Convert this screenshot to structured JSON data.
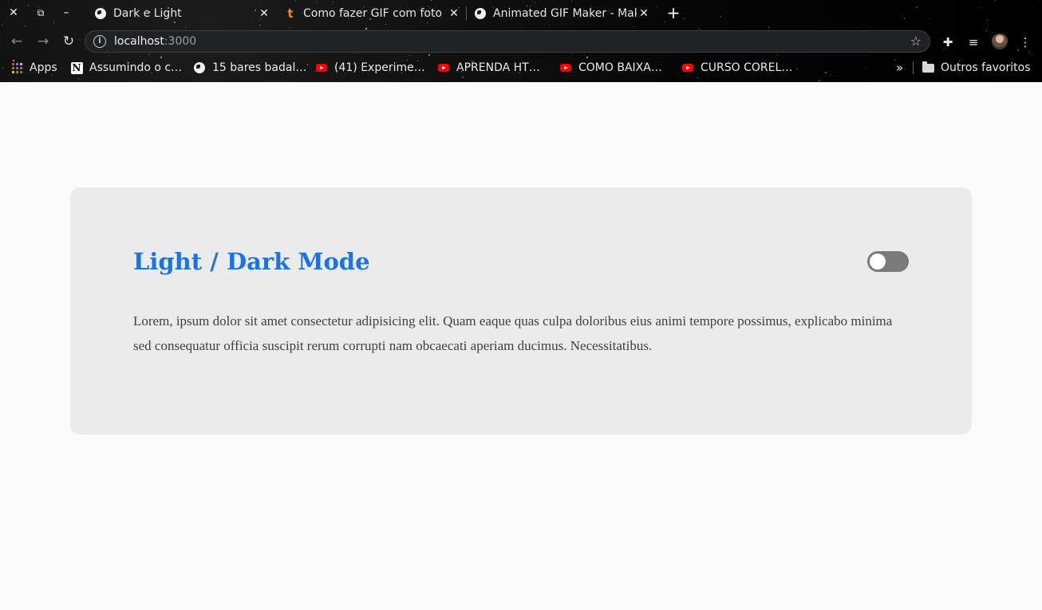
{
  "browser": {
    "tabs": [
      {
        "title": "Dark e Light",
        "favicon": "globe-icon",
        "active": true
      },
      {
        "title": "Como fazer GIF com foto",
        "favicon": "t-logo-icon",
        "active": false
      },
      {
        "title": "Animated GIF Maker - Mak",
        "favicon": "globe-icon",
        "active": false
      }
    ],
    "address": {
      "host": "localhost",
      "port": ":3000"
    },
    "bookmarks": [
      {
        "label": "Apps",
        "icon": "apps-grid-icon"
      },
      {
        "label": "Assumindo o c…",
        "icon": "notion-icon"
      },
      {
        "label": "15 bares badal…",
        "icon": "globe-icon"
      },
      {
        "label": "(41) Experime…",
        "icon": "youtube-icon"
      },
      {
        "label": "APRENDA HT…",
        "icon": "youtube-icon"
      },
      {
        "label": "COMO BAIXA…",
        "icon": "youtube-icon"
      },
      {
        "label": "CURSO COREL…",
        "icon": "youtube-icon"
      }
    ],
    "overflow_label": "»",
    "other_bookmarks": "Outros favoritos"
  },
  "page": {
    "title": "Light / Dark Mode",
    "body": "Lorem, ipsum dolor sit amet consectetur adipisicing elit. Quam eaque quas culpa doloribus eius animi tempore possimus, explicabo minima sed consequatur officia suscipit rerum corrupti nam obcaecati aperiam ducimus. Necessitatibus.",
    "theme_toggle": {
      "state": "off"
    }
  },
  "colors": {
    "title": "#1a73e8",
    "card_bg": "#ebebeb",
    "page_bg": "#fbfbfb",
    "toggle_track": "#7a7a7a"
  }
}
